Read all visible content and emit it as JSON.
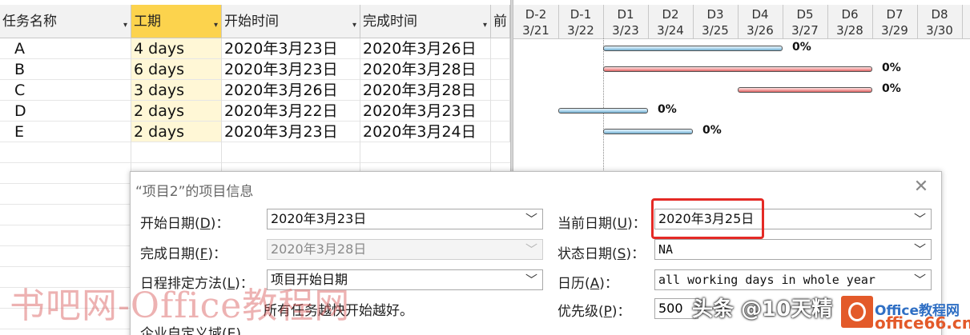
{
  "columns": [
    {
      "label": "任务名称",
      "selected": false
    },
    {
      "label": "工期",
      "selected": true
    },
    {
      "label": "开始时间",
      "selected": false
    },
    {
      "label": "完成时间",
      "selected": false
    },
    {
      "label": "前",
      "selected": false
    }
  ],
  "tasks": [
    {
      "name": "A",
      "duration": "4 days",
      "start": "2020年3月23日",
      "finish": "2020年3月26日",
      "percent": "0%",
      "color": "blue"
    },
    {
      "name": "B",
      "duration": "6 days",
      "start": "2020年3月23日",
      "finish": "2020年3月28日",
      "percent": "0%",
      "color": "red"
    },
    {
      "name": "C",
      "duration": "3 days",
      "start": "2020年3月26日",
      "finish": "2020年3月28日",
      "percent": "0%",
      "color": "red"
    },
    {
      "name": "D",
      "duration": "2 days",
      "start": "2020年3月22日",
      "finish": "2020年3月23日",
      "percent": "0%",
      "color": "blue"
    },
    {
      "name": "E",
      "duration": "2 days",
      "start": "2020年3月23日",
      "finish": "2020年3月24日",
      "percent": "0%",
      "color": "blue"
    }
  ],
  "timeline": {
    "days": [
      "D-2",
      "D-1",
      "D1",
      "D2",
      "D3",
      "D4",
      "D5",
      "D6",
      "D7",
      "D8"
    ],
    "dates": [
      "3/21",
      "3/22",
      "3/23",
      "3/24",
      "3/25",
      "3/26",
      "3/27",
      "3/28",
      "3/29",
      "3/30"
    ]
  },
  "dialog": {
    "title": "“项目2”的项目信息",
    "close_icon": "close-icon",
    "start_label": "开始日期",
    "start_key": "D",
    "start_value": "2020年3月23日",
    "finish_label": "完成日期",
    "finish_key": "F",
    "finish_value": "2020年3月28日",
    "schedule_label": "日程排定方法",
    "schedule_key": "L",
    "schedule_value": "项目开始日期",
    "current_label": "当前日期",
    "current_key": "U",
    "current_value": "2020年3月25日",
    "status_label": "状态日期",
    "status_key": "S",
    "status_value": "NA",
    "calendar_label": "日历",
    "calendar_key": "A",
    "calendar_value": "all working days in whole year",
    "priority_label": "优先级",
    "priority_key": "P",
    "priority_value": "500",
    "note": "所有任务越快开始越好。",
    "custom_label": "企业自定义域",
    "custom_key": "E",
    "highlight_color": "#e42a25"
  },
  "watermarks": {
    "left": "书吧网-Office教程网",
    "right": "头条 @10天精",
    "brand": "Office教程网",
    "url": "office66.cn"
  }
}
